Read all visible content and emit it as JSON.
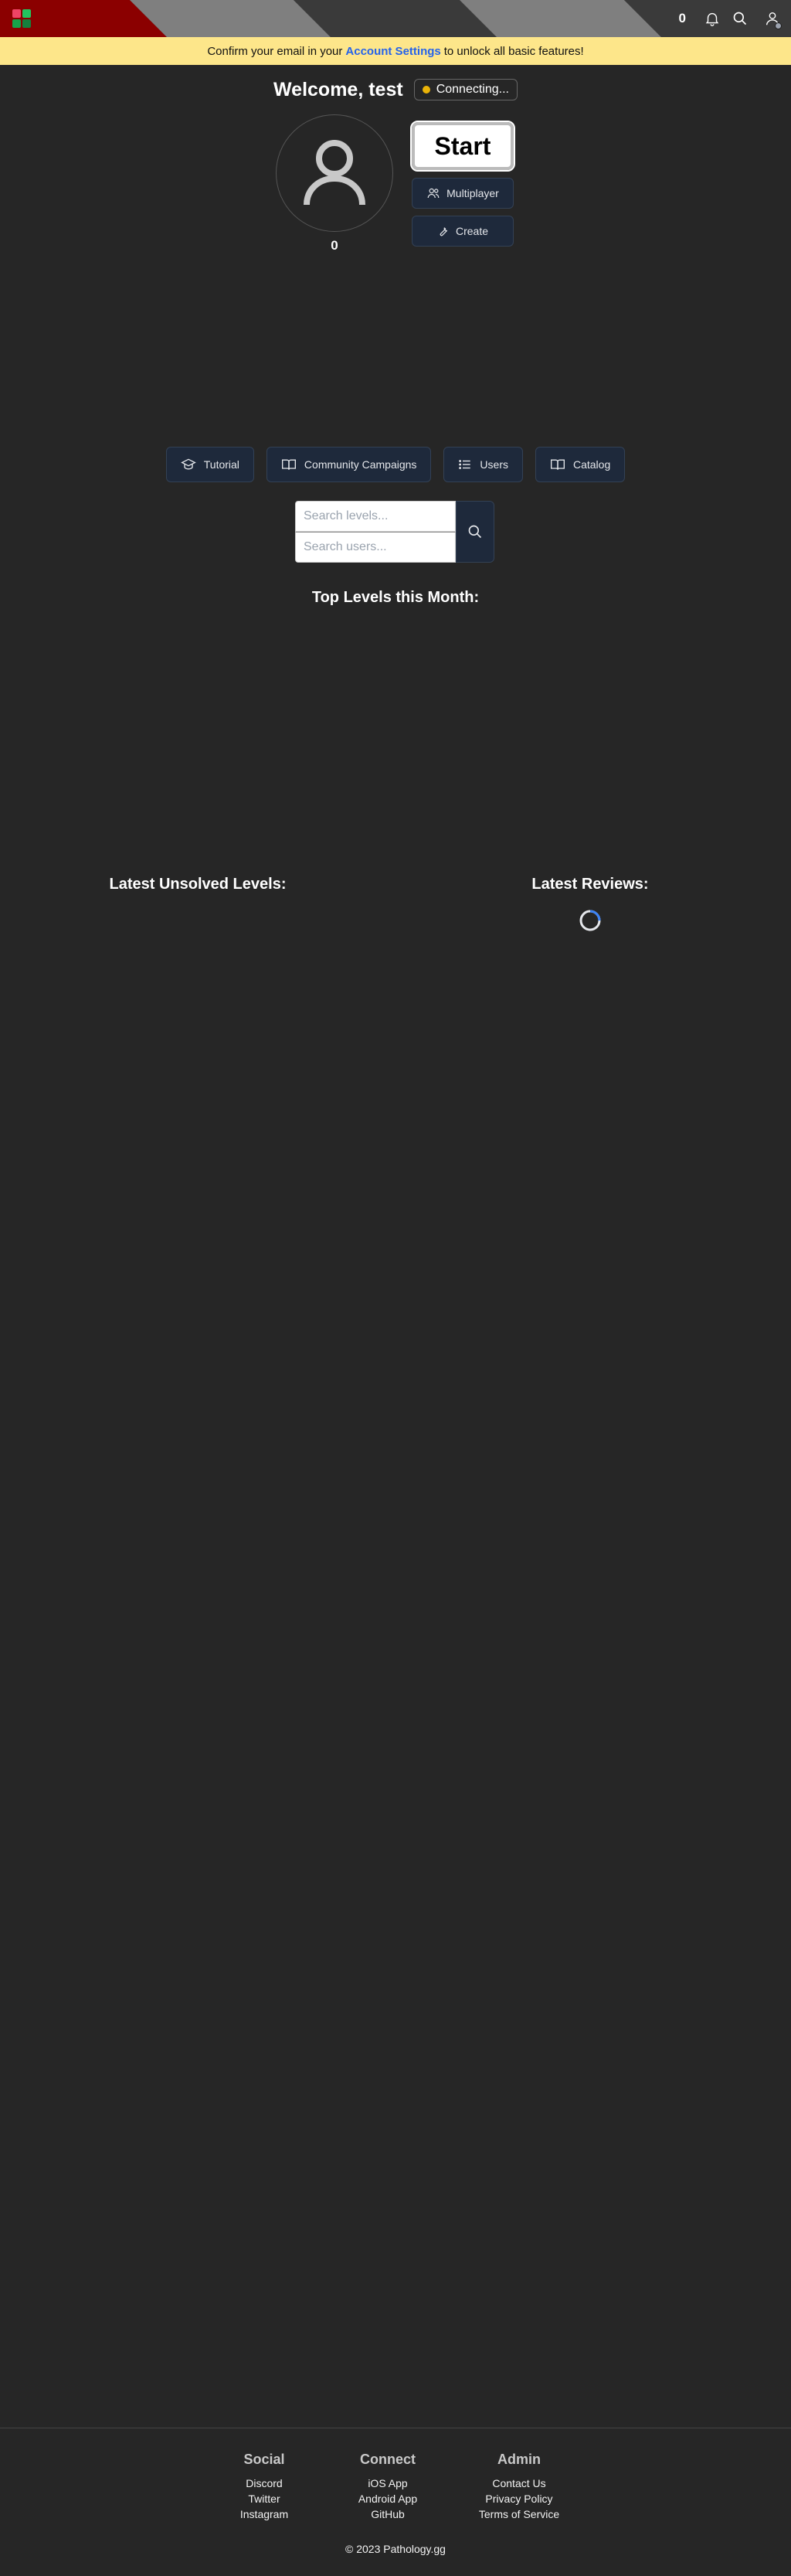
{
  "header": {
    "streak_count": "0",
    "colors": {
      "red": "#8b0000",
      "stripe_light": "#7f7f7f",
      "stripe_dark": "#3a3a3a"
    }
  },
  "banner": {
    "text_before": "Confirm your email in your",
    "link_label": "Account Settings",
    "text_after": "to unlock all basic features!"
  },
  "welcome": {
    "title": "Welcome, test",
    "status": "Connecting..."
  },
  "profile": {
    "score": "0"
  },
  "actions": {
    "start_label": "Start",
    "multiplayer_label": "Multiplayer",
    "create_label": "Create"
  },
  "nav": {
    "tutorial": "Tutorial",
    "community_campaigns": "Community Campaigns",
    "users": "Users",
    "catalog": "Catalog"
  },
  "search": {
    "levels_placeholder": "Search levels...",
    "users_placeholder": "Search users..."
  },
  "sections": {
    "top_levels": "Top Levels this Month:",
    "latest_unsolved": "Latest Unsolved Levels:",
    "latest_reviews": "Latest Reviews:"
  },
  "footer": {
    "social": {
      "title": "Social",
      "links": [
        "Discord",
        "Twitter",
        "Instagram"
      ]
    },
    "connect": {
      "title": "Connect",
      "links": [
        "iOS App",
        "Android App",
        "GitHub"
      ]
    },
    "admin": {
      "title": "Admin",
      "links": [
        "Contact Us",
        "Privacy Policy",
        "Terms of Service"
      ]
    },
    "copyright": "© 2023 Pathology.gg"
  }
}
